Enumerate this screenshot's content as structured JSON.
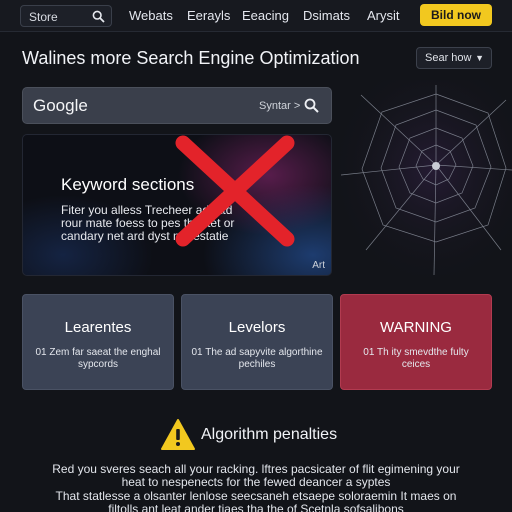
{
  "nav": {
    "search_text": "Store",
    "links": [
      "Webats",
      "Eerayls",
      "Eeacing",
      "Dsimats",
      "Arysit"
    ],
    "cta_label": "Bild now"
  },
  "page_title": "Walines more Search Engine Optimization",
  "sort_label": "Sear how",
  "google_bar": {
    "logo": "Google",
    "syntax_label": "Syntar >"
  },
  "hero": {
    "title": "Keyword sections",
    "lines": [
      "Fiter you alless Trecheer ad tatd",
      "rour mate foess to pes the ttet or",
      "candary net ard dyst me estatie"
    ],
    "corner_label": "Art"
  },
  "cards": [
    {
      "title": "Learentes",
      "text": "01 Zem far saeat the enghal sypcords"
    },
    {
      "title": "Levelors",
      "text": "01 The ad sapyvite algorthine pechiles"
    },
    {
      "title": "WARNING",
      "text": "01 Th ity smevdthe fulty ceices"
    }
  ],
  "penalties": {
    "title": "Algorithm penalties",
    "lines": [
      "Red you sveres seach all your racking. lftres pacsicater of flit egimening your",
      "heat to nespenects for the fewed deancer a syptes",
      "That statlesse a olsanter lenlose seecsaneh etsaepe soloraemin It maes on",
      "filtolls ant leat ander tiaes tha the of Scetnla sofsalibons"
    ]
  },
  "colors": {
    "background": "#121419",
    "accent_yellow": "#f2c81f",
    "card_blue": "#3b4355",
    "card_red": "#9a2a3f",
    "cross_red": "#e3232a"
  },
  "icons": [
    "search-icon",
    "close-cross-icon",
    "spider-web-icon",
    "warning-icon",
    "chevron-down-icon"
  ]
}
